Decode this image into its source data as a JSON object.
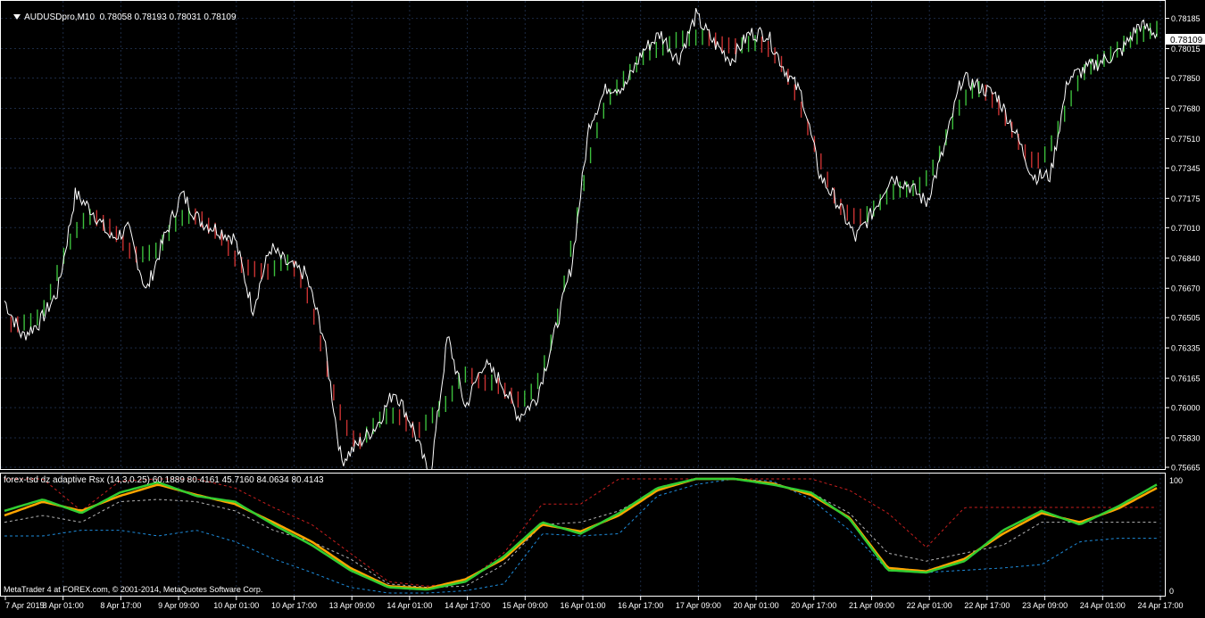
{
  "window": {
    "symbol_label": "AUDUSDpro,M10",
    "ohlc": "0.78058 0.78193 0.78031 0.78109",
    "current_price": "0.78109"
  },
  "indicator": {
    "label": "forex-tsd dz adaptive Rsx (14,3,0.25) 60.1889 80.4161 45.7160 84.0634 80.4143",
    "scale_max": "100",
    "scale_min": "0"
  },
  "footer": {
    "copyright": "MetaTrader 4 at FOREX.com, © 2001-2014, MetaQuotes Software Corp."
  },
  "colors": {
    "background": "#000000",
    "grid": "#1c2a44",
    "up_bar": "#3cbf3c",
    "down_bar": "#c83232",
    "price_line": "#ffffff",
    "rsx_main": "#32cd32",
    "rsx_signal": "#ffa500",
    "level_high": "#c81e1e",
    "level_low": "#1e8cdc",
    "level_mid": "#b4b4b4"
  },
  "chart_data": {
    "type": "line",
    "symbol": "AUDUSDpro",
    "timeframe": "M10",
    "y_ticks": [
      "0.78185",
      "0.78015",
      "0.77850",
      "0.77680",
      "0.77510",
      "0.77345",
      "0.77175",
      "0.77010",
      "0.76840",
      "0.76670",
      "0.76505",
      "0.76335",
      "0.76165",
      "0.76000",
      "0.75830",
      "0.75665"
    ],
    "ylim": [
      0.75665,
      0.78268
    ],
    "x_labels": [
      "7 Apr 2015",
      "8 Apr 01:00",
      "8 Apr 17:00",
      "9 Apr 09:00",
      "10 Apr 01:00",
      "10 Apr 17:00",
      "13 Apr 09:00",
      "14 Apr 01:00",
      "14 Apr 17:00",
      "15 Apr 09:00",
      "16 Apr 01:00",
      "16 Apr 17:00",
      "17 Apr 09:00",
      "20 Apr 01:00",
      "20 Apr 17:00",
      "21 Apr 09:00",
      "22 Apr 01:00",
      "22 Apr 17:00",
      "23 Apr 09:00",
      "24 Apr 01:00",
      "24 Apr 17:00"
    ],
    "price_series": [
      0.766,
      0.764,
      0.7648,
      0.7665,
      0.772,
      0.771,
      0.7695,
      0.77,
      0.7665,
      0.7695,
      0.772,
      0.7705,
      0.77,
      0.7695,
      0.7655,
      0.769,
      0.768,
      0.7675,
      0.764,
      0.757,
      0.758,
      0.759,
      0.761,
      0.759,
      0.756,
      0.764,
      0.76,
      0.7625,
      0.7615,
      0.7595,
      0.7605,
      0.764,
      0.768,
      0.776,
      0.778,
      0.778,
      0.78,
      0.781,
      0.7795,
      0.782,
      0.7805,
      0.7795,
      0.781,
      0.781,
      0.779,
      0.7775,
      0.773,
      0.7715,
      0.7695,
      0.771,
      0.773,
      0.7725,
      0.7715,
      0.7745,
      0.7785,
      0.778,
      0.7775,
      0.7755,
      0.773,
      0.773,
      0.7785,
      0.779,
      0.7795,
      0.78,
      0.7815,
      0.781
    ],
    "rsx_main": [
      72,
      82,
      70,
      88,
      97,
      85,
      80,
      60,
      42,
      20,
      5,
      3,
      10,
      32,
      62,
      52,
      70,
      92,
      100,
      100,
      95,
      88,
      65,
      20,
      18,
      28,
      55,
      72,
      60,
      76,
      95
    ],
    "rsx_signal": [
      68,
      80,
      72,
      85,
      95,
      86,
      78,
      62,
      45,
      22,
      6,
      4,
      12,
      30,
      60,
      54,
      68,
      90,
      100,
      100,
      96,
      86,
      66,
      22,
      19,
      30,
      52,
      70,
      62,
      74,
      92
    ],
    "level_high": [
      100,
      100,
      72,
      98,
      100,
      100,
      92,
      75,
      60,
      35,
      10,
      6,
      10,
      35,
      78,
      78,
      100,
      100,
      100,
      100,
      100,
      100,
      90,
      70,
      40,
      75,
      75,
      75,
      75,
      75,
      75
    ],
    "level_low": [
      50,
      50,
      55,
      55,
      50,
      55,
      45,
      30,
      18,
      5,
      0,
      0,
      2,
      8,
      52,
      50,
      52,
      85,
      95,
      100,
      98,
      82,
      55,
      20,
      18,
      20,
      22,
      25,
      45,
      48,
      48
    ],
    "level_mid": [
      62,
      68,
      62,
      80,
      82,
      80,
      72,
      55,
      45,
      30,
      8,
      5,
      6,
      25,
      60,
      62,
      72,
      90,
      100,
      100,
      95,
      88,
      70,
      35,
      28,
      35,
      42,
      62,
      62,
      62,
      62
    ],
    "rsx_ylim": [
      0,
      100
    ]
  }
}
